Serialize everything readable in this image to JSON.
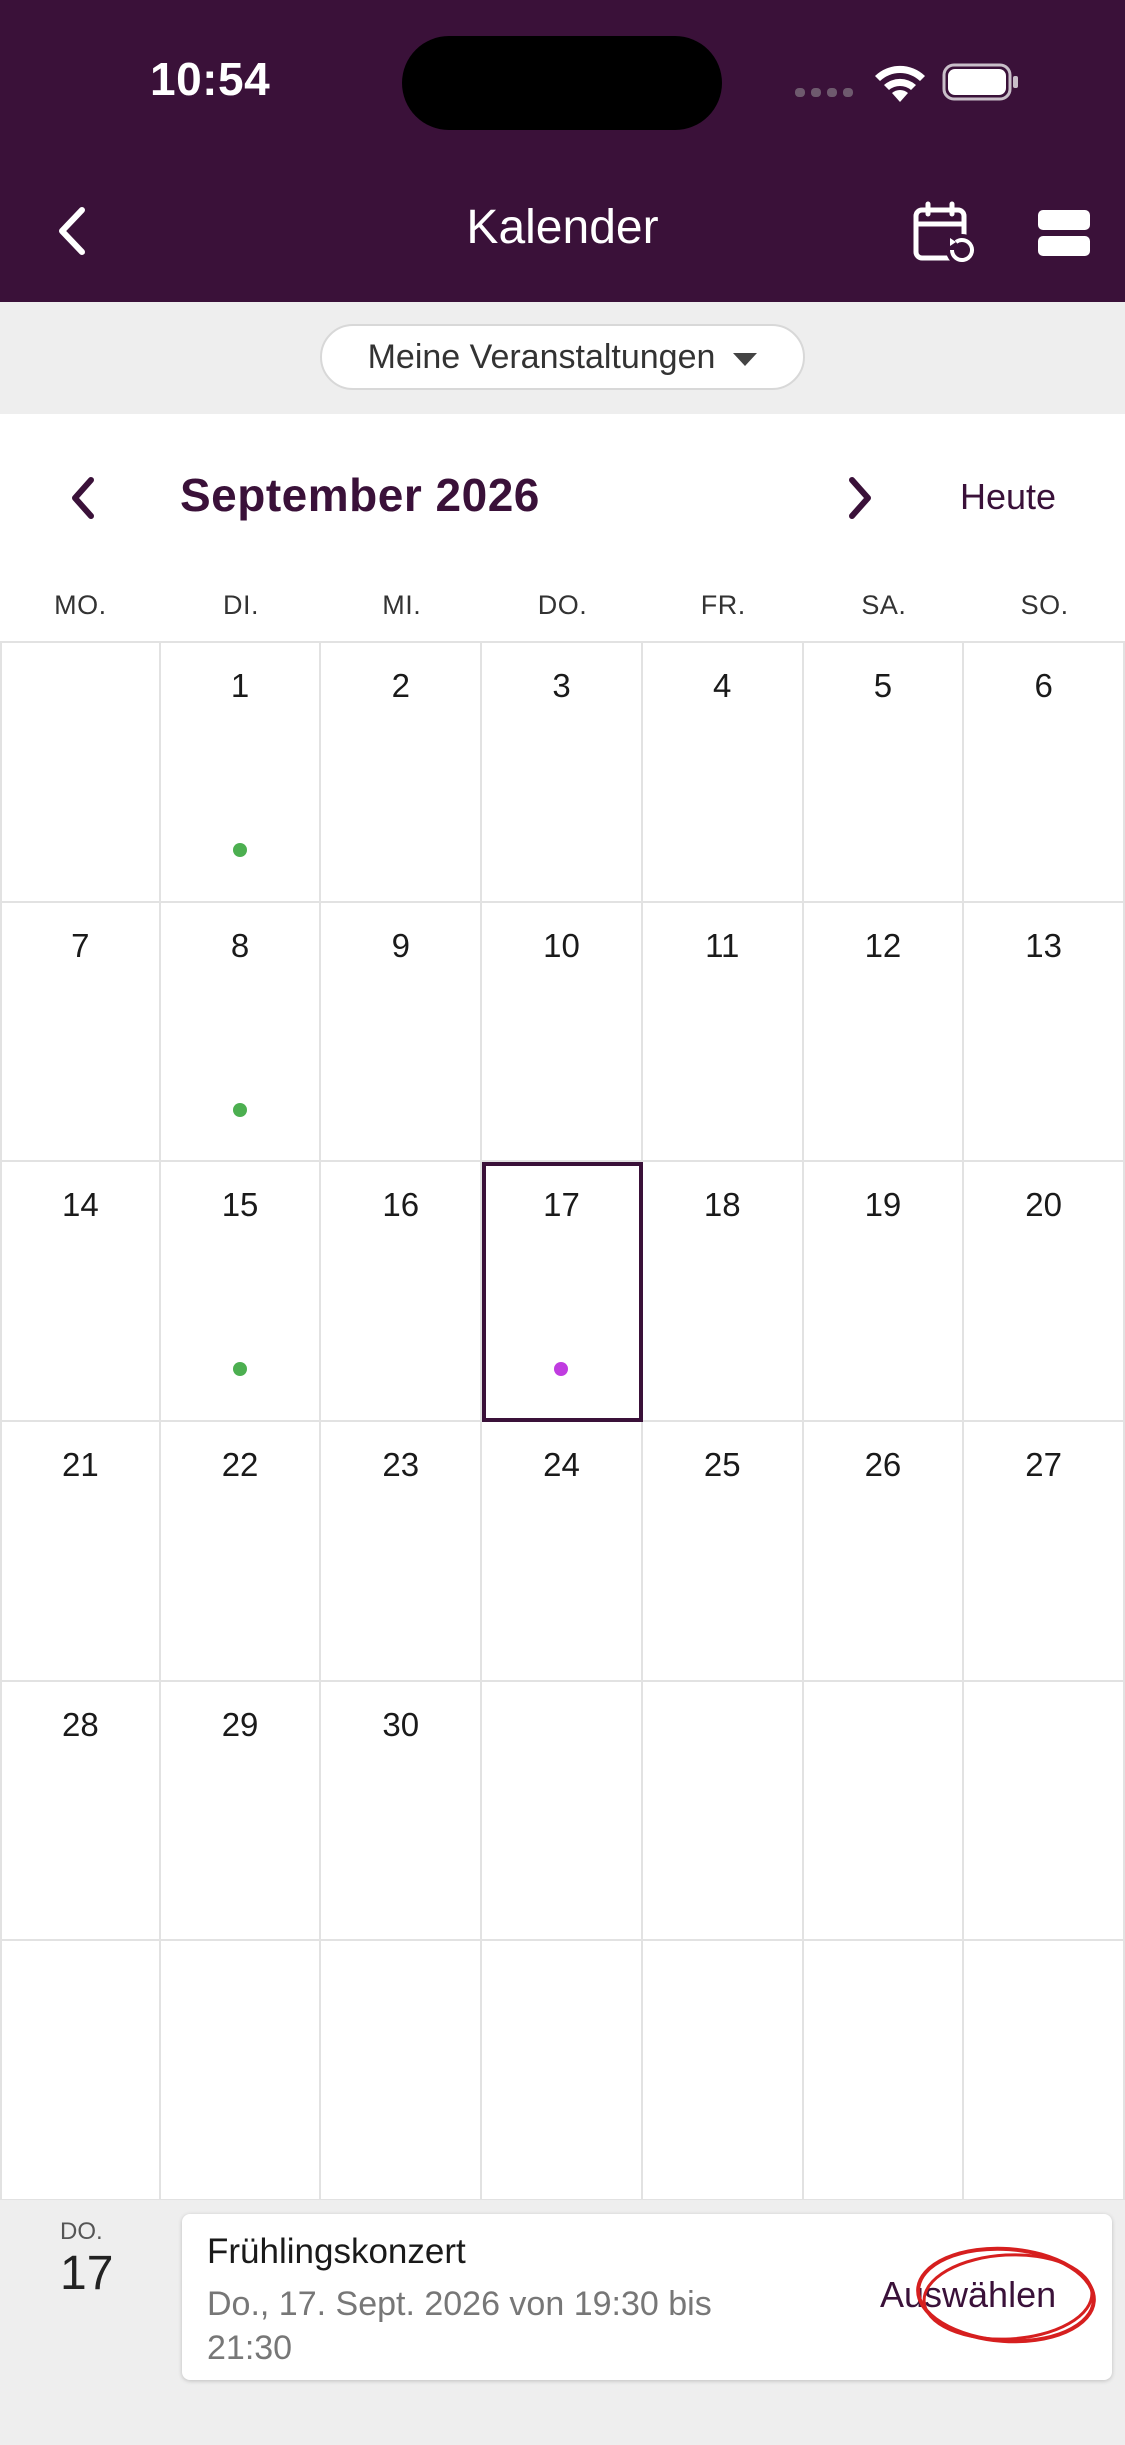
{
  "status_bar": {
    "time": "10:54"
  },
  "header": {
    "title": "Kalender",
    "background": "#3a1139"
  },
  "filter": {
    "label": "Meine Veranstaltungen"
  },
  "month_nav": {
    "title": "September 2026",
    "today_label": "Heute"
  },
  "weekdays": [
    "MO.",
    "DI.",
    "MI.",
    "DO.",
    "FR.",
    "SA.",
    "SO."
  ],
  "days": [
    {
      "n": ""
    },
    {
      "n": "1",
      "dot": "#4caf50"
    },
    {
      "n": "2"
    },
    {
      "n": "3"
    },
    {
      "n": "4"
    },
    {
      "n": "5"
    },
    {
      "n": "6"
    },
    {
      "n": "7"
    },
    {
      "n": "8",
      "dot": "#4caf50"
    },
    {
      "n": "9"
    },
    {
      "n": "10"
    },
    {
      "n": "11"
    },
    {
      "n": "12"
    },
    {
      "n": "13"
    },
    {
      "n": "14"
    },
    {
      "n": "15",
      "dot": "#4caf50"
    },
    {
      "n": "16"
    },
    {
      "n": "17",
      "dot": "#c03ce0",
      "selected": true
    },
    {
      "n": "18"
    },
    {
      "n": "19"
    },
    {
      "n": "20"
    },
    {
      "n": "21"
    },
    {
      "n": "22"
    },
    {
      "n": "23"
    },
    {
      "n": "24"
    },
    {
      "n": "25"
    },
    {
      "n": "26"
    },
    {
      "n": "27"
    },
    {
      "n": "28"
    },
    {
      "n": "29"
    },
    {
      "n": "30"
    },
    {
      "n": ""
    },
    {
      "n": ""
    },
    {
      "n": ""
    },
    {
      "n": ""
    },
    {
      "n": ""
    },
    {
      "n": ""
    },
    {
      "n": ""
    },
    {
      "n": ""
    },
    {
      "n": ""
    },
    {
      "n": ""
    },
    {
      "n": ""
    }
  ],
  "selected_day": {
    "weekday": "DO.",
    "day": "17"
  },
  "event": {
    "title": "Frühlingskonzert",
    "time": "Do., 17. Sept. 2026 von 19:30 bis 21:30",
    "action_label": "Auswählen"
  },
  "colors": {
    "accent": "#3a1139",
    "dot_green": "#4caf50",
    "dot_purple": "#c03ce0",
    "highlight_annotation": "#d61f1f"
  }
}
